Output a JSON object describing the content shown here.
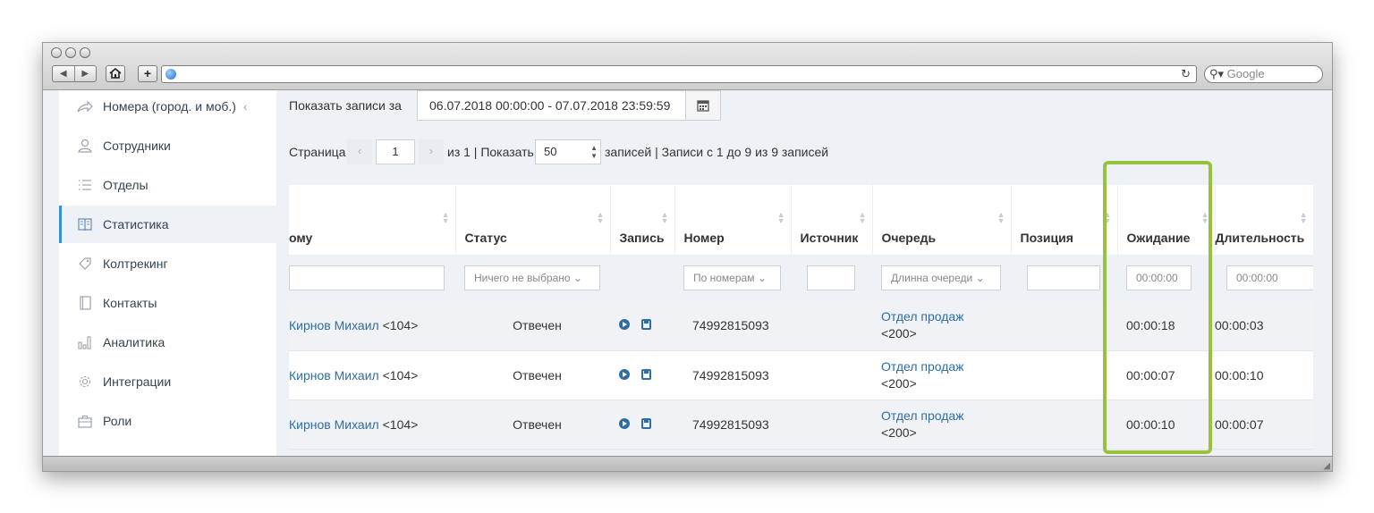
{
  "browser": {
    "search_placeholder": "Google",
    "reload_glyph": "↻",
    "new_tab_glyph": "+",
    "back_glyph": "◀",
    "forward_glyph": "▶"
  },
  "sidebar": {
    "items": [
      {
        "label": "Номера (город. и моб.)",
        "icon": "share-arrow-icon",
        "active": false,
        "expand": "‹"
      },
      {
        "label": "Сотрудники",
        "icon": "user-icon",
        "active": false
      },
      {
        "label": "Отделы",
        "icon": "list-icon",
        "active": false
      },
      {
        "label": "Статистика",
        "icon": "book-icon",
        "active": true
      },
      {
        "label": "Колтрекинг",
        "icon": "tag-icon",
        "active": false
      },
      {
        "label": "Контакты",
        "icon": "contacts-book-icon",
        "active": false
      },
      {
        "label": "Аналитика",
        "icon": "bar-chart-icon",
        "active": false
      },
      {
        "label": "Интеграции",
        "icon": "gear-icon",
        "active": false
      },
      {
        "label": "Роли",
        "icon": "briefcase-icon",
        "active": false
      }
    ]
  },
  "filter": {
    "show_records_label": "Показать записи за",
    "date_range": "06.07.2018 00:00:00 - 07.07.2018 23:59:59"
  },
  "pagination": {
    "page_label": "Страница",
    "prev": "‹",
    "next": "›",
    "current_page": "1",
    "of_show": "из 1 | Показать",
    "per_page": "50",
    "summary": "записей | Записи с 1 до 9 из 9 записей"
  },
  "table": {
    "columns": [
      "ому",
      "Статус",
      "Запись",
      "Номер",
      "Источник",
      "Очередь",
      "Позиция",
      "Ожидание",
      "Длительность"
    ],
    "filters": {
      "status": "Ничего не выбрано",
      "number": "По номерам",
      "queue": "Длинна очереди",
      "wait": "00:00:00",
      "duration": "00:00:00"
    },
    "rows": [
      {
        "to_name": "Кирнов Михаил",
        "to_ext": "<104>",
        "status": "Отвечен",
        "number": "74992815093",
        "source": "",
        "queue_name": "Отдел продаж",
        "queue_ext": "<200>",
        "position": "",
        "wait": "00:00:18",
        "duration": "00:00:03"
      },
      {
        "to_name": "Кирнов Михаил",
        "to_ext": "<104>",
        "status": "Отвечен",
        "number": "74992815093",
        "source": "",
        "queue_name": "Отдел продаж",
        "queue_ext": "<200>",
        "position": "",
        "wait": "00:00:07",
        "duration": "00:00:10"
      },
      {
        "to_name": "Кирнов Михаил",
        "to_ext": "<104>",
        "status": "Отвечен",
        "number": "74992815093",
        "source": "",
        "queue_name": "Отдел продаж",
        "queue_ext": "<200>",
        "position": "",
        "wait": "00:00:10",
        "duration": "00:00:07"
      }
    ]
  },
  "colors": {
    "accent": "#2e6da4",
    "highlight": "#98c23d",
    "active_border": "#3c8ecf"
  }
}
